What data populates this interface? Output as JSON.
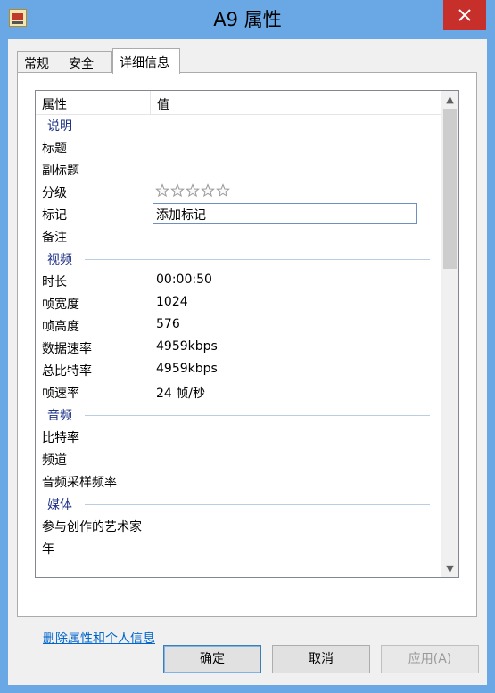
{
  "window": {
    "title": "A9 属性"
  },
  "tabs": [
    {
      "label": "常规",
      "active": false
    },
    {
      "label": "安全",
      "active": false
    },
    {
      "label": "详细信息",
      "active": true
    }
  ],
  "columns": {
    "property": "属性",
    "value": "值"
  },
  "groups": {
    "description": {
      "title": "说明",
      "rows": [
        {
          "name": "标题",
          "value": ""
        },
        {
          "name": "副标题",
          "value": ""
        },
        {
          "name": "分级",
          "value": "",
          "rating_stars": 5,
          "rating_filled": 0
        },
        {
          "name": "标记",
          "value": "添加标记"
        },
        {
          "name": "备注",
          "value": ""
        }
      ]
    },
    "video": {
      "title": "视频",
      "rows": [
        {
          "name": "时长",
          "value": "00:00:50"
        },
        {
          "name": "帧宽度",
          "value": "1024"
        },
        {
          "name": "帧高度",
          "value": "576"
        },
        {
          "name": "数据速率",
          "value": "4959kbps"
        },
        {
          "name": "总比特率",
          "value": "4959kbps"
        },
        {
          "name": "帧速率",
          "value": "24 帧/秒"
        }
      ]
    },
    "audio": {
      "title": "音频",
      "rows": [
        {
          "name": "比特率",
          "value": ""
        },
        {
          "name": "频道",
          "value": ""
        },
        {
          "name": "音频采样频率",
          "value": ""
        }
      ]
    },
    "media": {
      "title": "媒体",
      "rows": [
        {
          "name": "参与创作的艺术家",
          "value": ""
        },
        {
          "name": "年",
          "value": ""
        }
      ]
    }
  },
  "links": {
    "remove_properties": "删除属性和个人信息"
  },
  "buttons": {
    "ok": "确定",
    "cancel": "取消",
    "apply": "应用(A)"
  },
  "colors": {
    "title_bar": "#6aa7e5",
    "close_button": "#c7302a",
    "group_header": "#1e3287",
    "link": "#0066cc"
  }
}
